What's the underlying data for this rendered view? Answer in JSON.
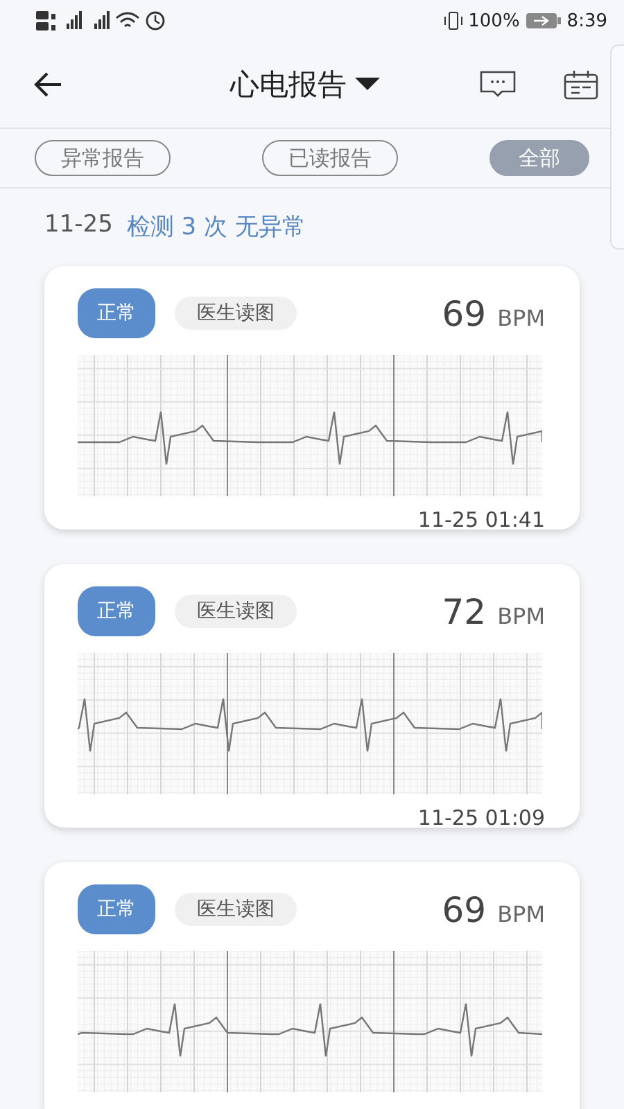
{
  "status_bar": {
    "battery": "100%",
    "time": "8:39"
  },
  "header": {
    "title": "心电报告"
  },
  "filters": [
    {
      "label": "异常报告",
      "selected": false
    },
    {
      "label": "已读报告",
      "selected": false
    },
    {
      "label": "全部",
      "selected": true
    }
  ],
  "summary": {
    "date": "11-25",
    "text": "检测 3 次 无异常"
  },
  "records": [
    {
      "status": "正常",
      "reader": "医生读图",
      "bpm": "69",
      "unit": "BPM",
      "time": "11-25 01:41"
    },
    {
      "status": "正常",
      "reader": "医生读图",
      "bpm": "72",
      "unit": "BPM",
      "time": "11-25 01:09"
    },
    {
      "status": "正常",
      "reader": "医生读图",
      "bpm": "69",
      "unit": "BPM"
    }
  ]
}
